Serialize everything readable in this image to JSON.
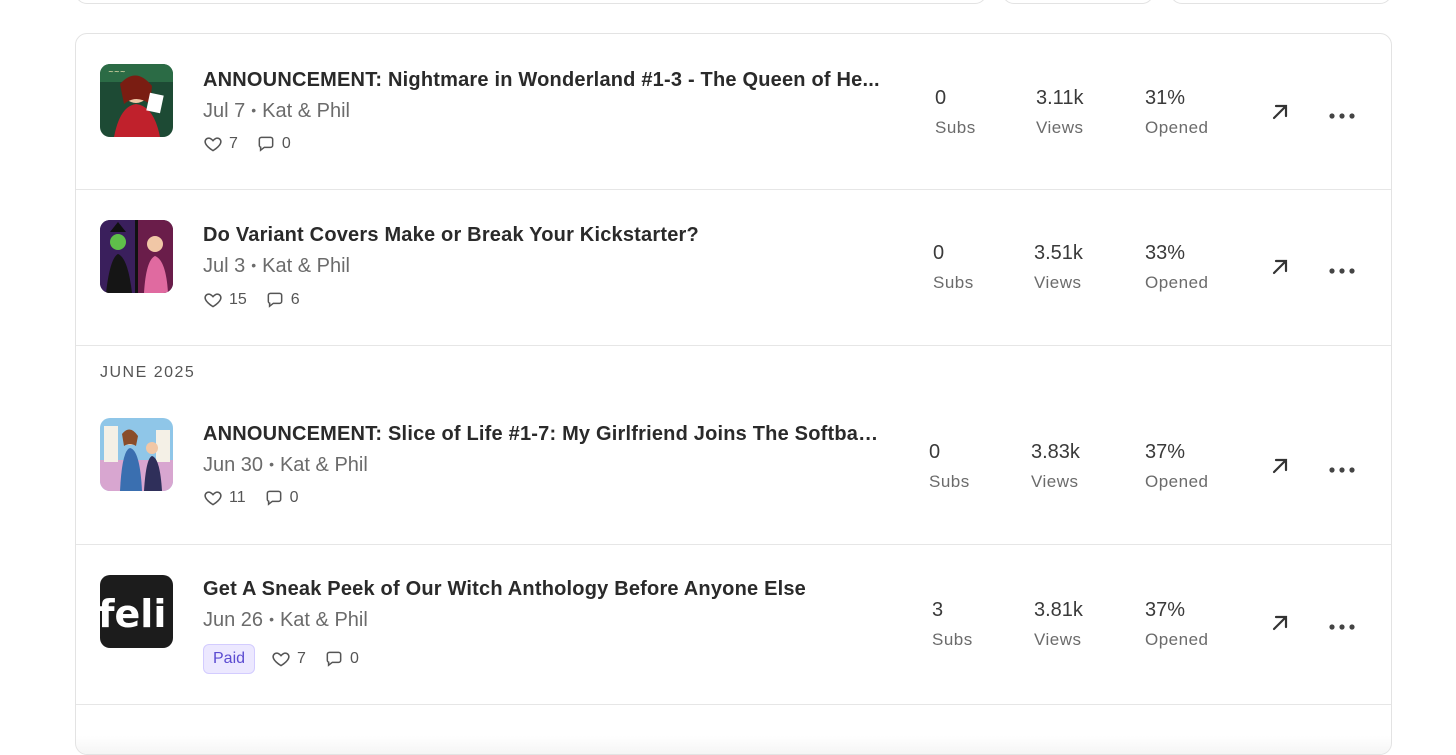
{
  "posts": [
    {
      "title": "ANNOUNCEMENT: Nightmare in Wonderland #1-3 - The Queen of He...",
      "date": "Jul 7",
      "author": "Kat & Phil",
      "likes": "7",
      "comments": "0",
      "subs": "0",
      "subs_label": "Subs",
      "views": "3.11k",
      "views_label": "Views",
      "opened": "31%",
      "opened_label": "Opened",
      "thumb_icon": "comic-cover-nightmare-thumbnail"
    },
    {
      "title": "Do Variant Covers Make or Break Your Kickstarter?",
      "date": "Jul 3",
      "author": "Kat & Phil",
      "likes": "15",
      "comments": "6",
      "subs": "0",
      "subs_label": "Subs",
      "views": "3.51k",
      "views_label": "Views",
      "opened": "33%",
      "opened_label": "Opened",
      "thumb_icon": "variant-covers-thumbnail"
    },
    {
      "title": "ANNOUNCEMENT: Slice of Life #1-7: My Girlfriend Joins The Softball...",
      "date": "Jun 30",
      "author": "Kat & Phil",
      "likes": "11",
      "comments": "0",
      "subs": "0",
      "subs_label": "Subs",
      "views": "3.83k",
      "views_label": "Views",
      "opened": "37%",
      "opened_label": "Opened",
      "thumb_icon": "slice-of-life-thumbnail"
    },
    {
      "title": "Get A Sneak Peek of Our Witch Anthology Before Anyone Else",
      "date": "Jun 26",
      "author": "Kat & Phil",
      "badge": "Paid",
      "likes": "7",
      "comments": "0",
      "subs": "3",
      "subs_label": "Subs",
      "views": "3.81k",
      "views_label": "Views",
      "opened": "37%",
      "opened_label": "Opened",
      "thumb_icon": "logo-thumbnail"
    }
  ],
  "month_header": "JUNE 2025",
  "colors": {
    "paid_badge_bg": "#ece8ff",
    "paid_badge_text": "#5b4bd1",
    "border": "#e3e3e3"
  },
  "icons": {
    "like": "heart-icon",
    "comment": "comment-icon",
    "open": "arrow-up-right-icon",
    "more": "more-horizontal-icon"
  }
}
